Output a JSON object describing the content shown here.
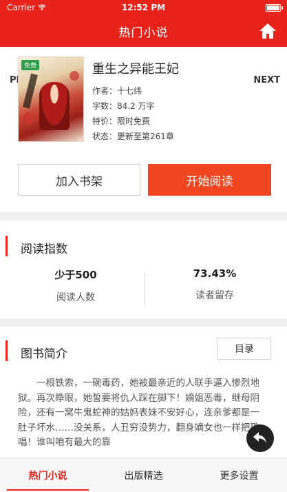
{
  "status_bar": {
    "carrier": "Carrier",
    "time": "12:52 PM"
  },
  "nav": {
    "title": "热门小说",
    "home_icon": "home-icon"
  },
  "book": {
    "prev_label": "PREV",
    "next_label": "NEXT",
    "cover_tag": "免费",
    "title": "重生之异能王妃",
    "meta": [
      {
        "key": "作者：",
        "value": "十七纬"
      },
      {
        "key": "字数：",
        "value": "84.2 万字"
      },
      {
        "key": "特价：",
        "value": "限时免费"
      },
      {
        "key": "状态：",
        "value": "更新至第261章"
      }
    ]
  },
  "actions": {
    "add_shelf": "加入书架",
    "start_read": "开始阅读"
  },
  "reading_index": {
    "header": "阅读指数",
    "readers_value": "少于500",
    "readers_label": "阅读人数",
    "retention_value": "73.43%",
    "retention_label": "读者留存"
  },
  "summary": {
    "header": "图书简介",
    "catalog_button": "目录",
    "text": "一根铁索，一碗毒药，她被最亲近的人联手逼入惨烈地狱。再次睁眼，她誓要将仇人踩在脚下！嫡姐恶毒，继母阴险，还有一窝牛鬼蛇神的姑妈表妹不安好心，连亲爹都是一肚子坏水……没关系，人丑穷没势力，翻身嫡女也一样把歌唱！谁叫咱有最大的靠"
  },
  "tabs": [
    {
      "label": "热门小说",
      "active": true
    },
    {
      "label": "出版精选",
      "active": false
    },
    {
      "label": "更多设置",
      "active": false
    }
  ],
  "colors": {
    "brand_red": "#e8231c",
    "cta_orange": "#f0461f"
  }
}
